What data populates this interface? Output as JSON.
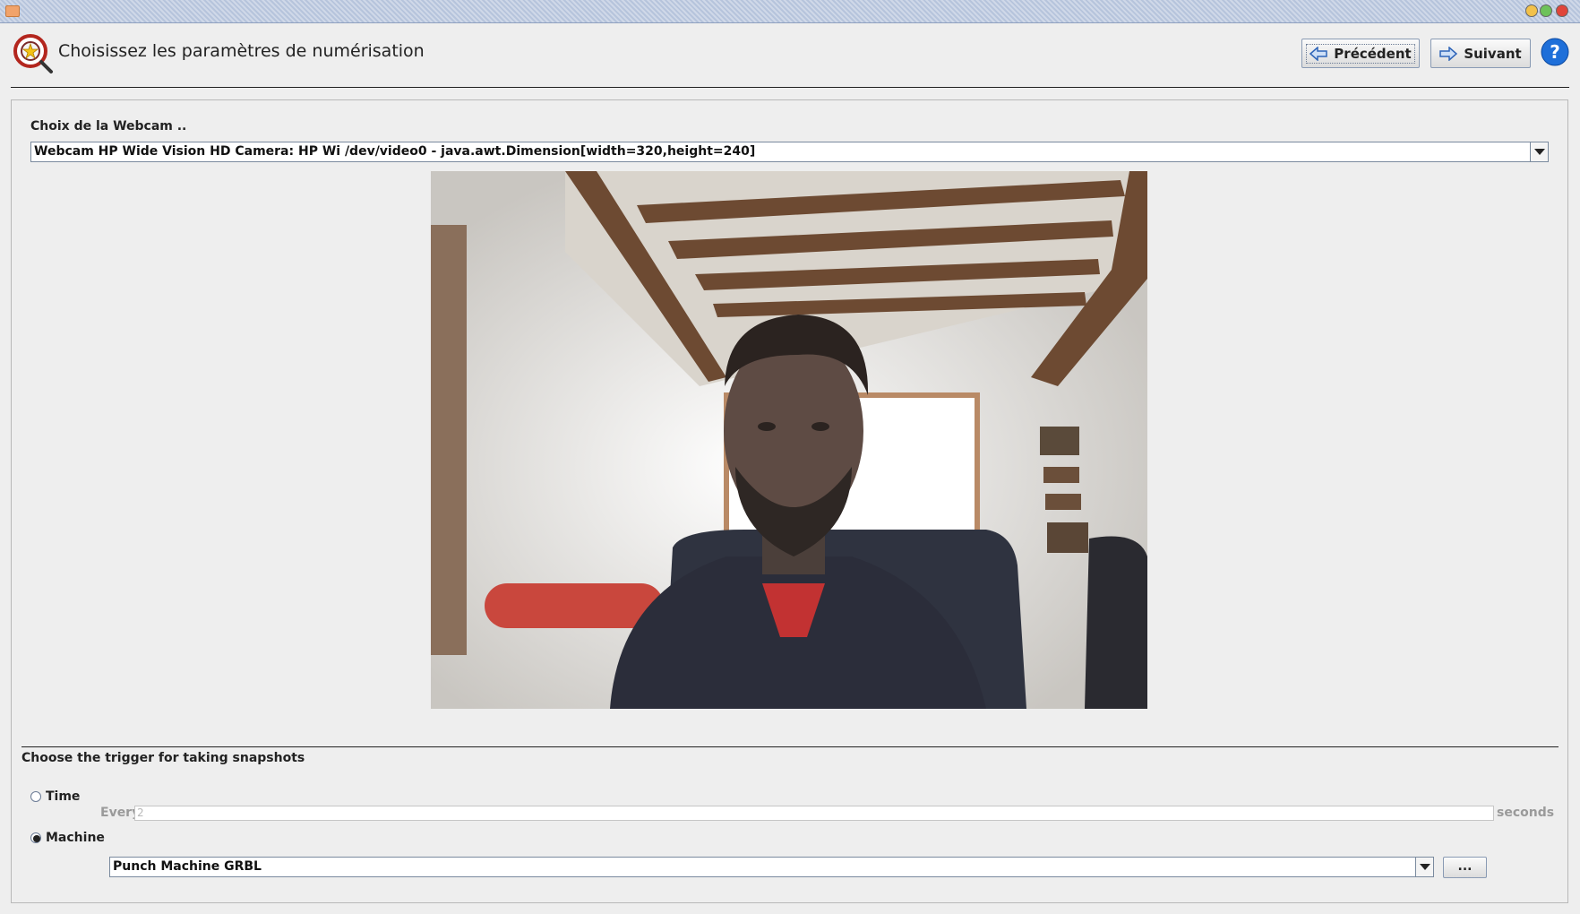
{
  "header": {
    "title": "Choisissez les paramètres de numérisation",
    "previous_label": "Précédent",
    "next_label": "Suivant",
    "help_label": "?"
  },
  "webcam": {
    "label": "Choix de la Webcam ..",
    "selected": "Webcam HP Wide Vision HD Camera: HP Wi /dev/video0 - java.awt.Dimension[width=320,height=240]"
  },
  "trigger": {
    "title": "Choose the trigger for taking snapshots",
    "time_label": "Time",
    "every_label": "Every",
    "every_value": "2",
    "seconds_label": "seconds",
    "machine_label": "Machine",
    "machine_selected": "Punch Machine GRBL",
    "more_label": "...",
    "selected_option": "machine"
  },
  "icons": {
    "header": "scan-wizard-icon",
    "previous": "arrow-left-icon",
    "next": "arrow-right-icon",
    "help": "help-icon"
  },
  "colors": {
    "accent_blue": "#1e6fd9",
    "background": "#eeeeee"
  }
}
